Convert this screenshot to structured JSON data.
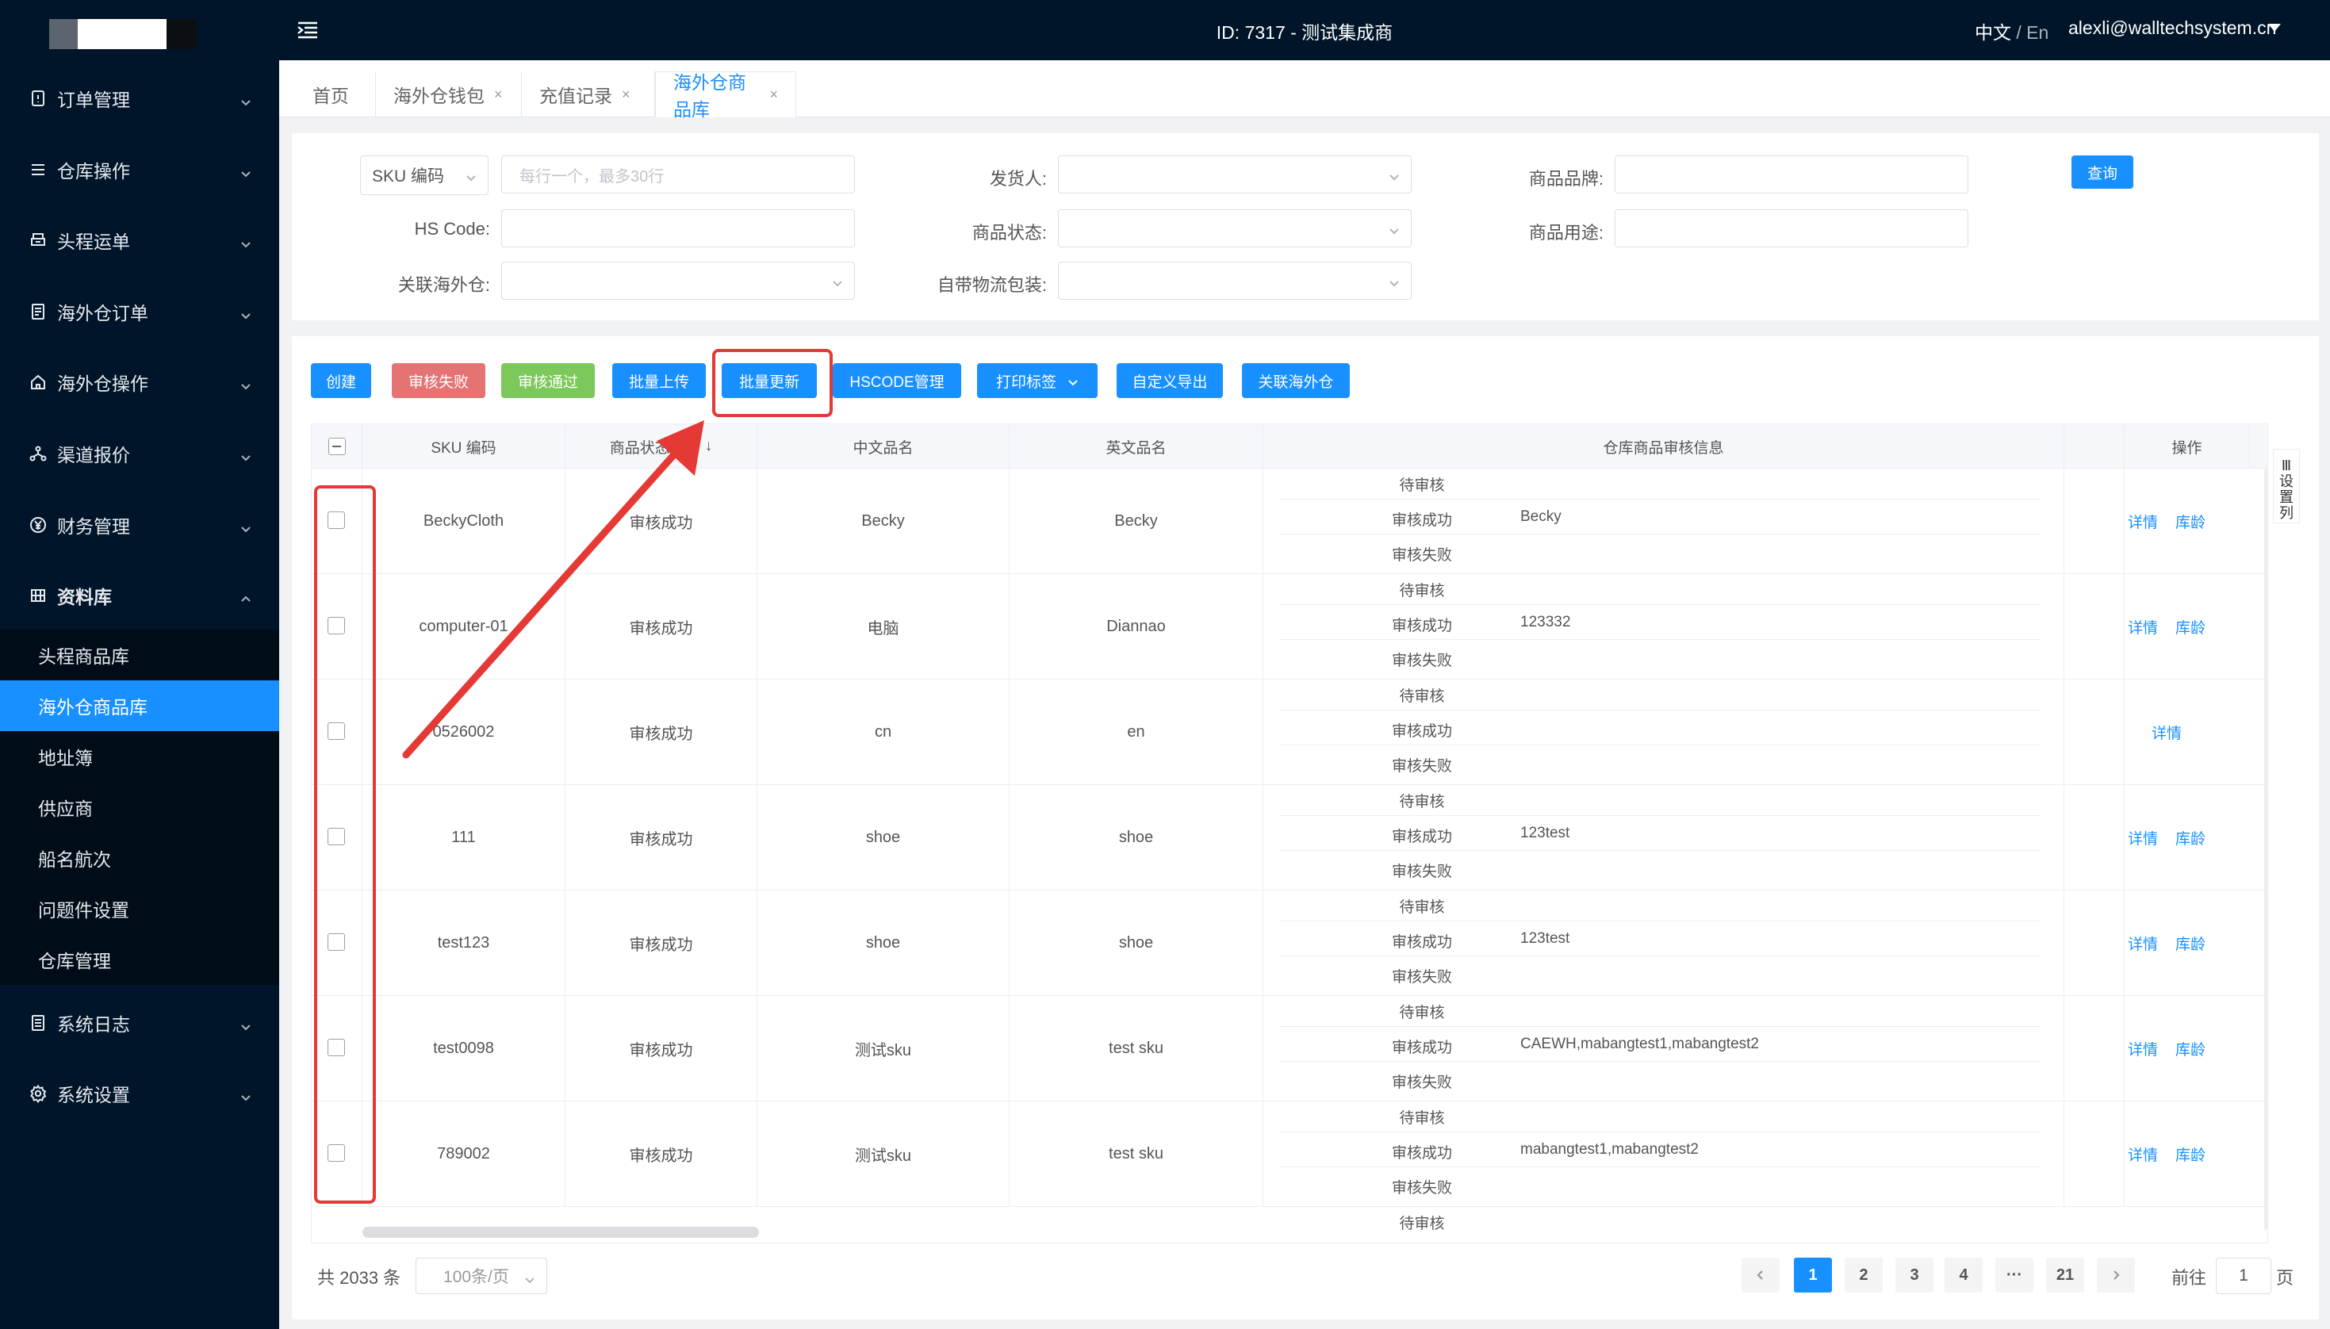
{
  "header": {
    "title": "ID: 7317 - 测试集成商",
    "lang_zh": "中文",
    "lang_sep": "/",
    "lang_en": "En",
    "user": "alexli@walltechsystem.cn"
  },
  "sidebar": {
    "menus": [
      {
        "label": "订单管理",
        "icon": "order-icon"
      },
      {
        "label": "仓库操作",
        "icon": "warehouse-icon"
      },
      {
        "label": "头程运单",
        "icon": "waybill-icon"
      },
      {
        "label": "海外仓订单",
        "icon": "document-icon"
      },
      {
        "label": "海外仓操作",
        "icon": "house-icon"
      },
      {
        "label": "渠道报价",
        "icon": "share-icon"
      },
      {
        "label": "财务管理",
        "icon": "yen-icon"
      },
      {
        "label": "资料库",
        "icon": "grid-icon"
      },
      {
        "label": "系统日志",
        "icon": "log-icon"
      },
      {
        "label": "系统设置",
        "icon": "gear-icon"
      }
    ],
    "submenu": [
      "头程商品库",
      "海外仓商品库",
      "地址簿",
      "供应商",
      "船名航次",
      "问题件设置",
      "仓库管理"
    ]
  },
  "tabs": [
    {
      "label": "首页",
      "closable": false
    },
    {
      "label": "海外仓钱包",
      "closable": true
    },
    {
      "label": "充值记录",
      "closable": true
    },
    {
      "label": "海外仓商品库",
      "closable": true
    }
  ],
  "filters": {
    "sku_type": "SKU 编码",
    "sku_placeholder": "每行一个，最多30行",
    "hs_code": "HS Code",
    "warehouse": "关联海外仓",
    "shipper": "发货人",
    "status": "商品状态",
    "packaging": "自带物流包装",
    "brand": "商品品牌",
    "usage": "商品用途",
    "colon": ":",
    "query": "查询"
  },
  "actions": {
    "create": "创建",
    "fail": "审核失败",
    "pass": "审核通过",
    "batch_upload": "批量上传",
    "batch_update": "批量更新",
    "hscode": "HSCODE管理",
    "print": "打印标签",
    "export": "自定义导出",
    "link": "关联海外仓"
  },
  "table": {
    "headers": {
      "sku": "SKU 编码",
      "status": "商品状态",
      "sort": "↓",
      "cn_name": "中文品名",
      "en_name": "英文品名",
      "review": "仓库商品审核信息",
      "ops": "操作"
    },
    "status_labels": [
      "待审核",
      "审核成功",
      "审核失败"
    ],
    "op_detail": "详情",
    "op_age": "库龄",
    "rows": [
      {
        "sku": "BeckyCloth",
        "status": "审核成功",
        "cn": "Becky",
        "en": "Becky",
        "ok": "Becky",
        "ops": [
          "详情",
          "库龄"
        ]
      },
      {
        "sku": "computer-01",
        "status": "审核成功",
        "cn": "电脑",
        "en": "Diannao",
        "ok": "123332",
        "ops": [
          "详情",
          "库龄"
        ]
      },
      {
        "sku": "0526002",
        "status": "审核成功",
        "cn": "cn",
        "en": "en",
        "ok": "",
        "ops": [
          "详情"
        ]
      },
      {
        "sku": "111",
        "status": "审核成功",
        "cn": "shoe",
        "en": "shoe",
        "ok": "123test",
        "ops": [
          "详情",
          "库龄"
        ]
      },
      {
        "sku": "test123",
        "status": "审核成功",
        "cn": "shoe",
        "en": "shoe",
        "ok": "123test",
        "ops": [
          "详情",
          "库龄"
        ]
      },
      {
        "sku": "test0098",
        "status": "审核成功",
        "cn": "测试sku",
        "en": "test sku",
        "ok": "CAEWH,mabangtest1,mabangtest2",
        "ops": [
          "详情",
          "库龄"
        ]
      },
      {
        "sku": "789002",
        "status": "审核成功",
        "cn": "测试sku",
        "en": "test sku",
        "ok": "mabangtest1,mabangtest2",
        "ops": [
          "详情",
          "库龄"
        ]
      }
    ],
    "partial_row_label": "待审核",
    "settings": [
      "设",
      "置",
      "列"
    ]
  },
  "pagination": {
    "total": "共 2033 条",
    "page_size": "100条/页",
    "pages": [
      "1",
      "2",
      "3",
      "4",
      "···",
      "21"
    ],
    "current": "1",
    "goto_label": "前往",
    "goto_value": "1",
    "goto_unit": "页"
  },
  "colors": {
    "primary": "#1890ff",
    "danger": "#e57373",
    "success": "#7cc85a",
    "sidebar": "#001529",
    "annotation": "#e53935"
  }
}
